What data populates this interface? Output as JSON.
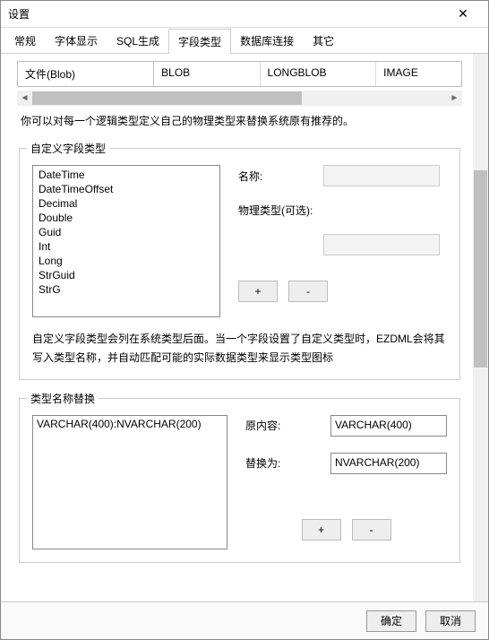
{
  "window": {
    "title": "设置",
    "close": "✕"
  },
  "tabs": [
    {
      "label": "常规",
      "active": false
    },
    {
      "label": "字体显示",
      "active": false
    },
    {
      "label": "SQL生成",
      "active": false
    },
    {
      "label": "字段类型",
      "active": true
    },
    {
      "label": "数据库连接",
      "active": false
    },
    {
      "label": "其它",
      "active": false
    }
  ],
  "type_row": {
    "c0": "文件(Blob)",
    "c1": "BLOB",
    "c2": "LONGBLOB",
    "c3": "IMAGE"
  },
  "hint1": "你可以对每一个逻辑类型定义自己的物理类型来替换系统原有推荐的。",
  "group_custom": {
    "title": "自定义字段类型",
    "items": [
      "DateTime",
      "DateTimeOffset",
      "Decimal",
      "Double",
      "Guid",
      "Int",
      "Long",
      "StrGuid",
      "StrG"
    ],
    "name_label": "名称:",
    "phys_label": "物理类型(可选):",
    "add": "+",
    "del": "-",
    "desc": "自定义字段类型会列在系统类型后面。当一个字段设置了自定义类型时，EZDML会将其写入类型名称，并自动匹配可能的实际数据类型来显示类型图标"
  },
  "group_replace": {
    "title": "类型名称替换",
    "items": [
      "VARCHAR(400):NVARCHAR(200)"
    ],
    "orig_label": "原内容:",
    "orig_value": "VARCHAR(400)",
    "repl_label": "替换为:",
    "repl_value": "NVARCHAR(200)",
    "add": "+",
    "del": "-"
  },
  "footer": {
    "ok": "确定",
    "cancel": "取消"
  }
}
